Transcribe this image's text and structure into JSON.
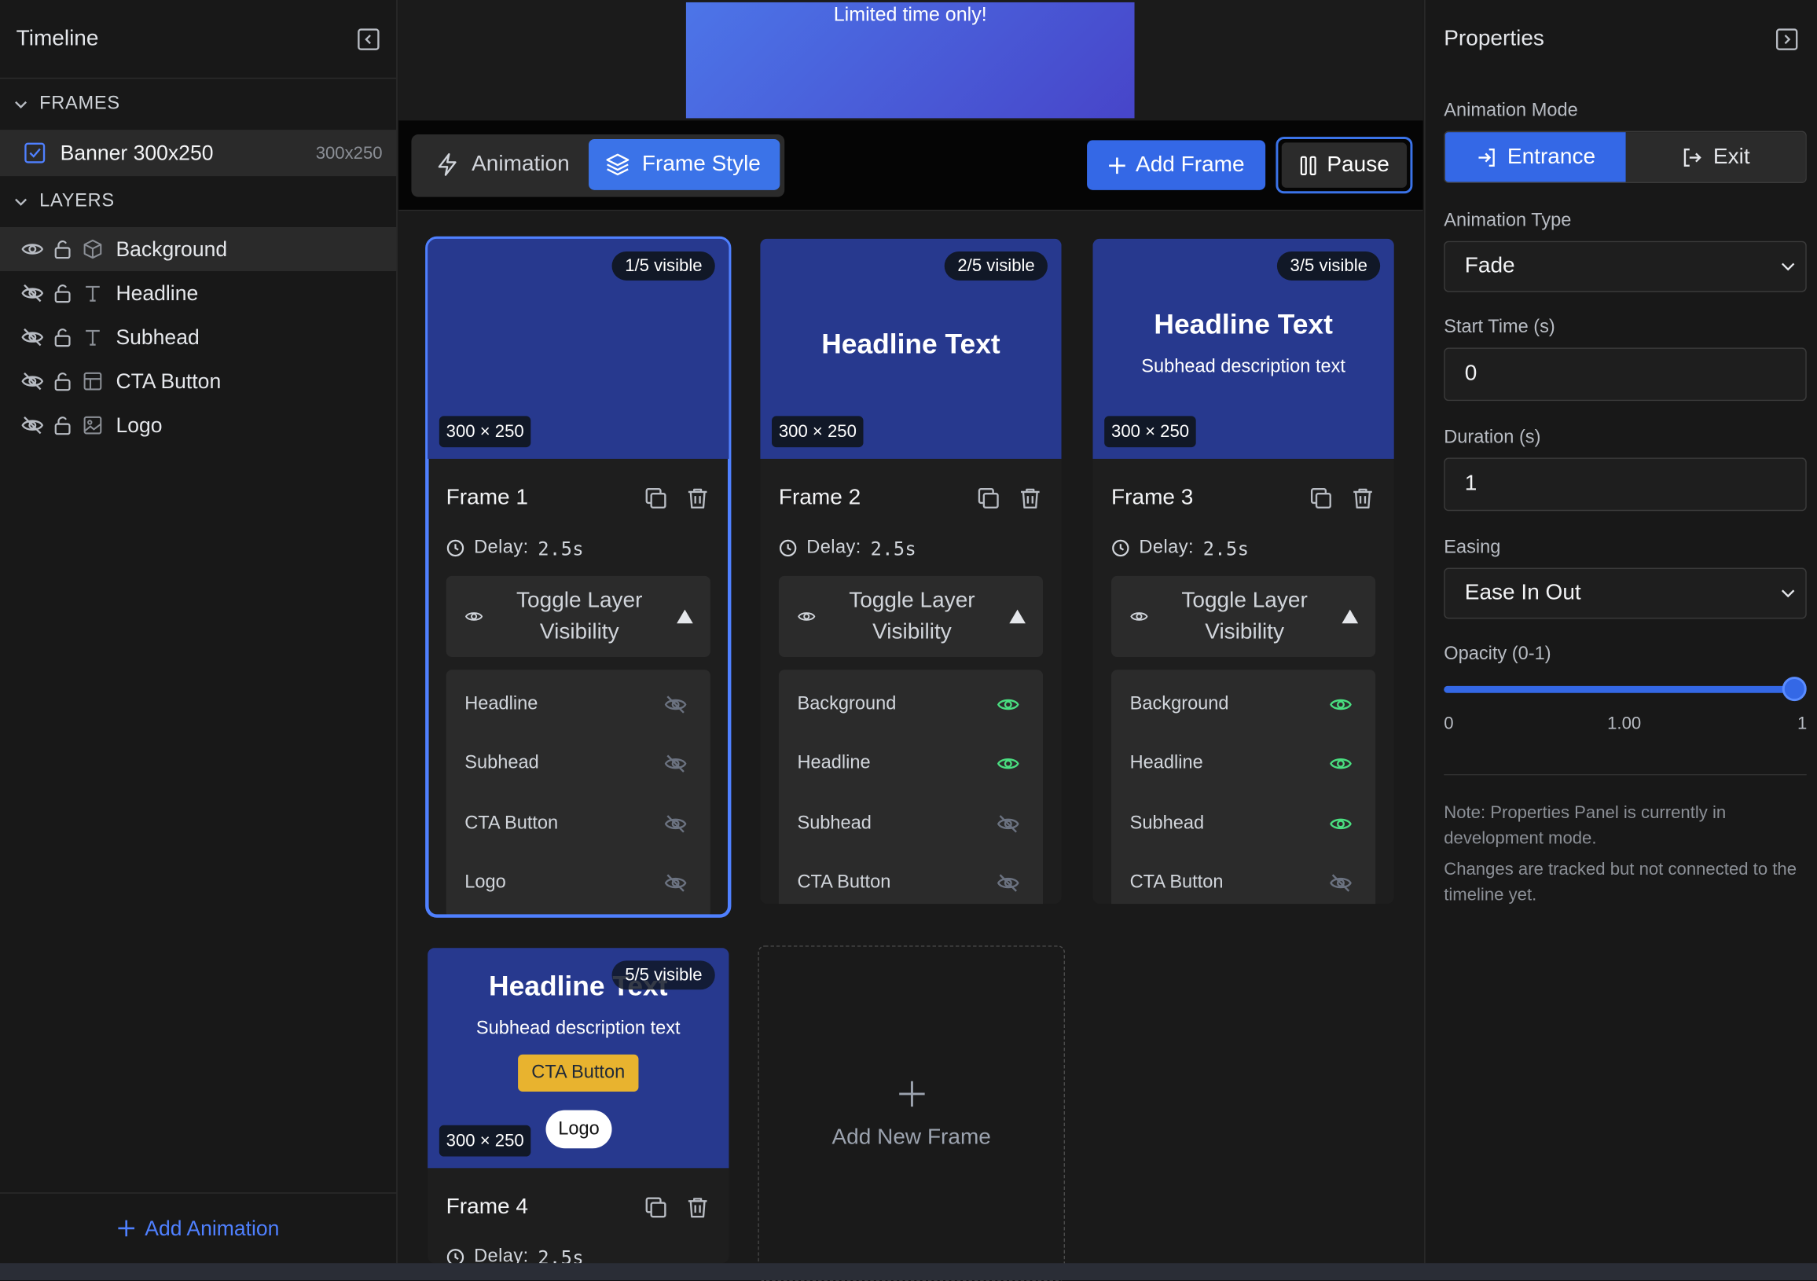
{
  "timeline": {
    "title": "Timeline",
    "frames_section": "FRAMES",
    "frame_item": {
      "name": "Banner 300x250",
      "size": "300x250"
    },
    "layers_section": "LAYERS",
    "layers": [
      {
        "name": "Background",
        "icon": "cube-icon",
        "visible": true
      },
      {
        "name": "Headline",
        "icon": "text-icon",
        "visible": false
      },
      {
        "name": "Subhead",
        "icon": "text-icon",
        "visible": false
      },
      {
        "name": "CTA Button",
        "icon": "layout-icon",
        "visible": false
      },
      {
        "name": "Logo",
        "icon": "image-icon",
        "visible": false
      }
    ],
    "add_animation": "Add Animation"
  },
  "preview": {
    "text": "Limited time only!"
  },
  "toolbar": {
    "tab_animation": "Animation",
    "tab_frame_style": "Frame Style",
    "add_frame": "Add Frame",
    "pause": "Pause"
  },
  "frames": [
    {
      "title": "Frame 1",
      "visible_badge": "1/5 visible",
      "size_badge": "300 × 250",
      "headline": "",
      "subhead": "",
      "delay": "2.5s",
      "toggle_label": "Toggle Layer Visibility",
      "layers": [
        {
          "name": "Headline",
          "visible": false
        },
        {
          "name": "Subhead",
          "visible": false
        },
        {
          "name": "CTA Button",
          "visible": false
        },
        {
          "name": "Logo",
          "visible": false
        }
      ]
    },
    {
      "title": "Frame 2",
      "visible_badge": "2/5 visible",
      "size_badge": "300 × 250",
      "headline": "Headline Text",
      "subhead": "",
      "delay": "2.5s",
      "toggle_label": "Toggle Layer Visibility",
      "layers": [
        {
          "name": "Background",
          "visible": true
        },
        {
          "name": "Headline",
          "visible": true
        },
        {
          "name": "Subhead",
          "visible": false
        },
        {
          "name": "CTA Button",
          "visible": false
        }
      ]
    },
    {
      "title": "Frame 3",
      "visible_badge": "3/5 visible",
      "size_badge": "300 × 250",
      "headline": "Headline Text",
      "subhead": "Subhead description text",
      "delay": "2.5s",
      "toggle_label": "Toggle Layer Visibility",
      "layers": [
        {
          "name": "Background",
          "visible": true
        },
        {
          "name": "Headline",
          "visible": true
        },
        {
          "name": "Subhead",
          "visible": true
        },
        {
          "name": "CTA Button",
          "visible": false
        }
      ]
    },
    {
      "title": "Frame 4",
      "visible_badge": "5/5 visible",
      "size_badge": "300 × 250",
      "headline": "Headline Text",
      "subhead": "Subhead description text",
      "cta": "CTA Button",
      "logo": "Logo",
      "delay": "2.5s"
    }
  ],
  "delay_prefix": "Delay:",
  "add_new_frame": "Add New Frame",
  "properties": {
    "title": "Properties",
    "animation_mode_label": "Animation Mode",
    "mode_entrance": "Entrance",
    "mode_exit": "Exit",
    "animation_type_label": "Animation Type",
    "animation_type": "Fade",
    "start_time_label": "Start Time (s)",
    "start_time": "0",
    "duration_label": "Duration (s)",
    "duration": "1",
    "easing_label": "Easing",
    "easing": "Ease In Out",
    "opacity_label": "Opacity (0-1)",
    "opacity_min": "0",
    "opacity_value": "1.00",
    "opacity_max": "1",
    "opacity_fraction": 1.0,
    "note1": "Note: Properties Panel is currently in development mode.",
    "note2": "Changes are tracked but not connected to the timeline yet."
  },
  "colors": {
    "accent": "#3468e6",
    "visible_green": "#4ade80",
    "frame_bg": "#27398e",
    "cta_yellow": "#e8b32f"
  }
}
